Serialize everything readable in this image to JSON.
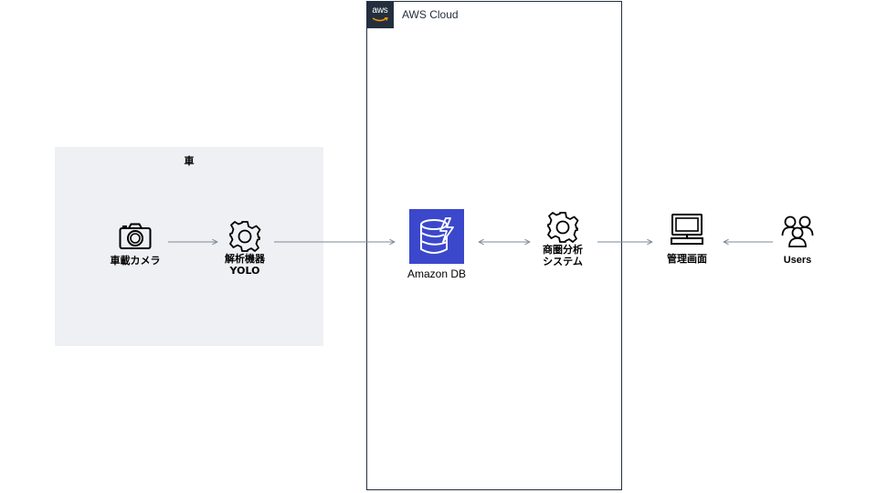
{
  "groups": {
    "car": {
      "label": "車"
    },
    "aws": {
      "label": "AWS Cloud",
      "logo_text": "aws"
    }
  },
  "nodes": {
    "camera": {
      "label": "車載カメラ",
      "icon": "camera-icon"
    },
    "analyzer": {
      "label": "解析機器\nYOLO",
      "icon": "gear-icon"
    },
    "db": {
      "label": "Amazon DB",
      "icon": "dynamodb-icon"
    },
    "analysis": {
      "label": "商圏分析\nシステム",
      "icon": "gear-icon"
    },
    "admin": {
      "label": "管理画面",
      "icon": "monitor-icon"
    },
    "users": {
      "label": "Users",
      "icon": "users-icon"
    }
  },
  "colors": {
    "aws_dark": "#232f3e",
    "dynamodb": "#3b48cc",
    "group_bg": "#eff0f3",
    "edge": "#7d8998"
  },
  "edges": [
    {
      "from": "camera",
      "to": "analyzer",
      "direction": "forward"
    },
    {
      "from": "analyzer",
      "to": "db",
      "direction": "forward"
    },
    {
      "from": "db",
      "to": "analysis",
      "direction": "both"
    },
    {
      "from": "analysis",
      "to": "admin",
      "direction": "forward"
    },
    {
      "from": "users",
      "to": "admin",
      "direction": "forward"
    }
  ]
}
